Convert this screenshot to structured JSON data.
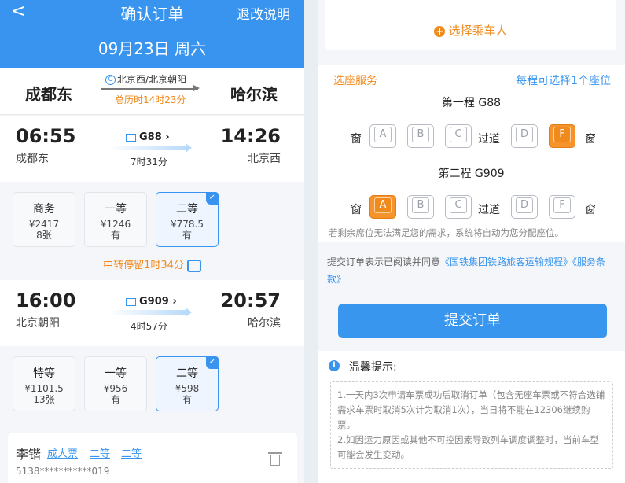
{
  "left": {
    "header": {
      "back": "<",
      "title": "确认订单",
      "refund": "退改说明",
      "date": "09月23日 周六"
    },
    "route": {
      "from": "成都东",
      "to": "哈尔滨",
      "via": "北京西/北京朝阳",
      "via_icon": "C",
      "total": "总历时14时23分"
    },
    "seg1": {
      "dep_time": "06:55",
      "dep_station": "成都东",
      "train": "G88 ›",
      "duration": "7时31分",
      "arr_time": "14:26",
      "arr_station": "北京西"
    },
    "seg1_seats": [
      {
        "name": "商务",
        "price": "¥2417",
        "avail": "8张"
      },
      {
        "name": "一等",
        "price": "¥1246",
        "avail": "有"
      },
      {
        "name": "二等",
        "price": "¥778.5",
        "avail": "有"
      }
    ],
    "transfer": "中转停留1时34分",
    "seg2": {
      "dep_time": "16:00",
      "dep_station": "北京朝阳",
      "train": "G909 ›",
      "duration": "4时57分",
      "arr_time": "20:57",
      "arr_station": "哈尔滨"
    },
    "seg2_seats": [
      {
        "name": "特等",
        "price": "¥1101.5",
        "avail": "13张"
      },
      {
        "name": "一等",
        "price": "¥956",
        "avail": "有"
      },
      {
        "name": "二等",
        "price": "¥598",
        "avail": "有"
      }
    ],
    "passenger": {
      "name": "李锴",
      "type": "成人票",
      "seat1": "二等",
      "seat2": "二等",
      "id": "5138***********019"
    },
    "check": "✓"
  },
  "right": {
    "add_passenger": "选择乘车人",
    "plus": "+",
    "seat_service": "选座服务",
    "seat_hint": "每程可选择1个座位",
    "leg1": "第一程 G88",
    "leg2": "第二程 G909",
    "window": "窗",
    "aisle": "过道",
    "seat_letters": [
      "A",
      "B",
      "C",
      "D",
      "F"
    ],
    "leg1_selected": "F",
    "leg2_selected": "A",
    "seat_note": "若剩余席位无法满足您的需求，系统将自动为您分配座位。",
    "agree_prefix": "提交订单表示已阅读并同意",
    "agree_link1": "《国铁集团铁路旅客运输规程》",
    "agree_link2": "《服务条款》",
    "submit": "提交订单",
    "tips_title": "温馨提示:",
    "tips_icon": "i",
    "tips": [
      "1.一天内3次申请车票成功后取消订单（包含无座车票或不符合选铺需求车票时取消5次计为取消1次），当日将不能在12306继续购票。",
      "2.如因运力原因或其他不可控因素导致列车调度调整时，当前车型可能会发生变动。"
    ]
  },
  "colors": {
    "primary": "#3894ee",
    "accent": "#f08a1c",
    "selected_seat": "#f6932a"
  }
}
